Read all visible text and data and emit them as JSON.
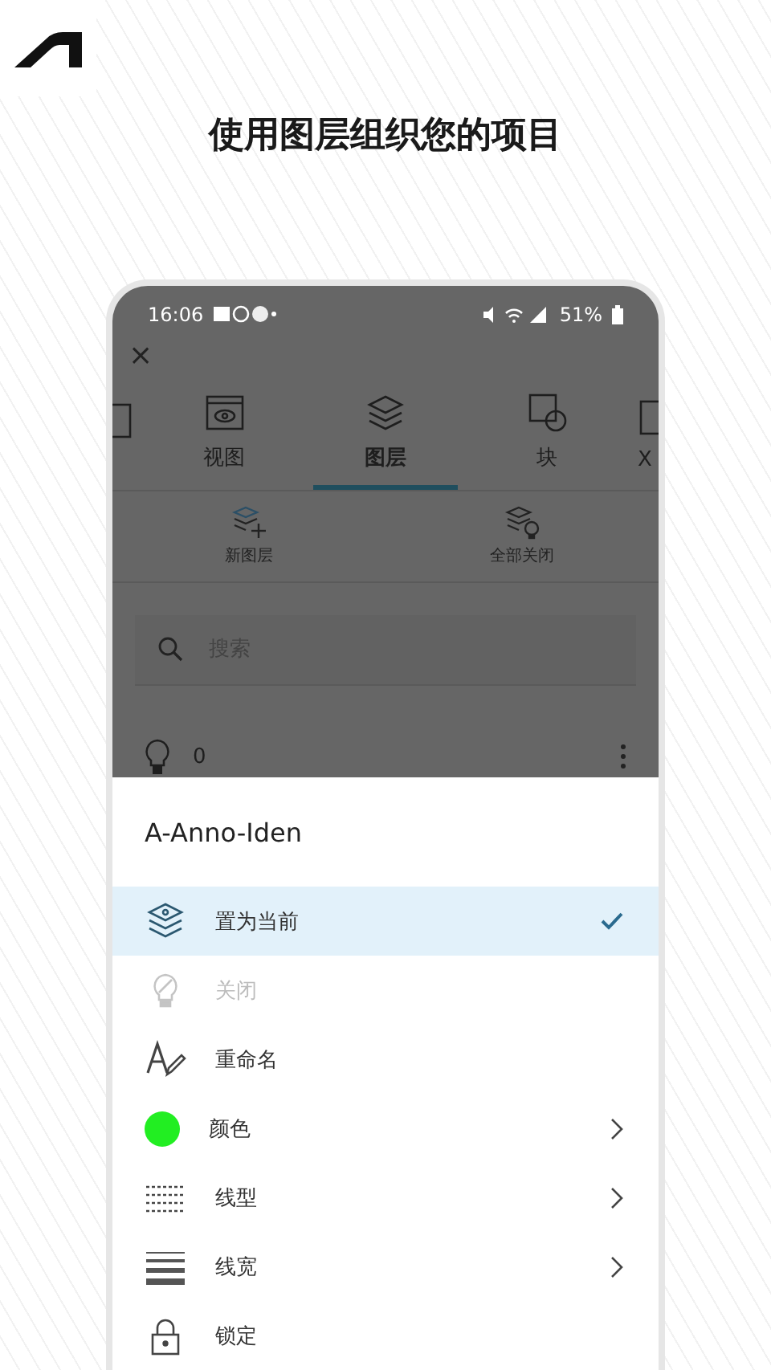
{
  "headline": "使用图层组织您的项目",
  "status_bar": {
    "time": "16:06",
    "battery": "51%"
  },
  "close": "×",
  "tabs": [
    {
      "kind": "eye",
      "label": "视图",
      "selected": false
    },
    {
      "kind": "layers",
      "label": "图层",
      "selected": true
    },
    {
      "kind": "block",
      "label": "块",
      "selected": false
    },
    {
      "kind": "panel",
      "label": "X",
      "selected": false
    }
  ],
  "toolbar": [
    {
      "kind": "add",
      "label": "新图层"
    },
    {
      "kind": "off",
      "label": "全部关闭"
    }
  ],
  "search": {
    "placeholder": "搜索"
  },
  "layer": {
    "name": "0"
  },
  "sheet": {
    "title": "A-Anno-Iden",
    "items": [
      {
        "kind": "layers",
        "label": "置为当前",
        "selected": true,
        "disabled": false,
        "chevron": false
      },
      {
        "kind": "bulb",
        "label": "关闭",
        "selected": false,
        "disabled": true,
        "chevron": false
      },
      {
        "kind": "rename",
        "label": "重命名",
        "selected": false,
        "disabled": false,
        "chevron": false
      },
      {
        "kind": "color",
        "label": "颜色",
        "color": "#22ee22",
        "selected": false,
        "disabled": false,
        "chevron": true
      },
      {
        "kind": "linetype",
        "label": "线型",
        "selected": false,
        "disabled": false,
        "chevron": true
      },
      {
        "kind": "lineweight",
        "label": "线宽",
        "selected": false,
        "disabled": false,
        "chevron": true
      },
      {
        "kind": "lock",
        "label": "锁定",
        "selected": false,
        "disabled": false,
        "chevron": false
      }
    ]
  }
}
